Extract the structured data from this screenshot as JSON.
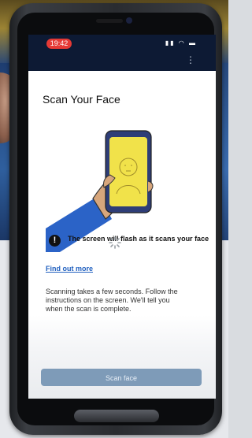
{
  "status_bar": {
    "time": "19:42",
    "icons": [
      "signal-icon",
      "wifi-icon",
      "battery-icon"
    ],
    "menu": "⋮"
  },
  "page": {
    "title": "Scan Your Face",
    "warning_text": "The screen will flash as it scans your face",
    "link": "Find out more",
    "body": "Scanning takes a few seconds. Follow the instructions on the screen. We'll tell you when the scan is complete.",
    "button": "Scan face"
  },
  "colors": {
    "status_bar_bg": "#0d1a34",
    "time_pill": "#e53935",
    "button_bg": "#7e9bb8",
    "link": "#1f5fbf",
    "phone_screen_illustration": "#f1e24a"
  }
}
